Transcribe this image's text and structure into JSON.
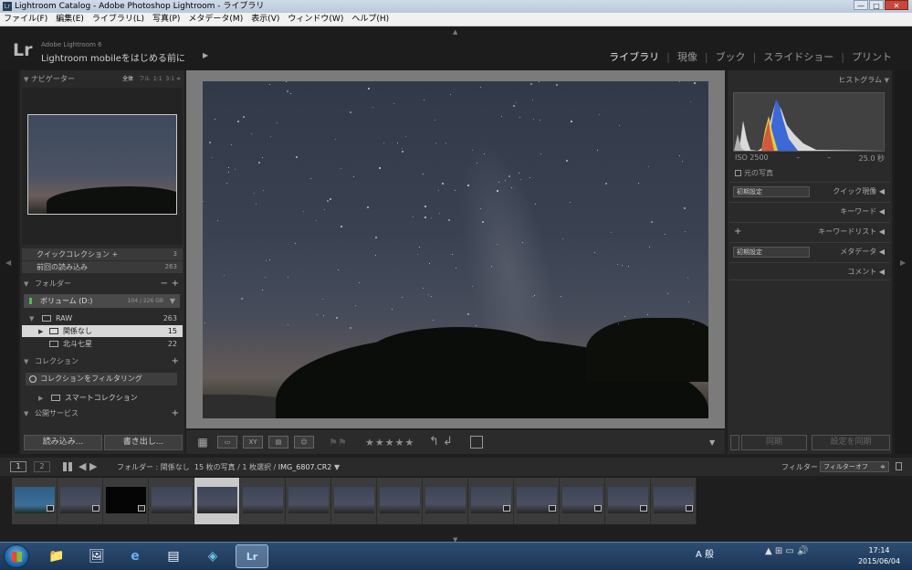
{
  "window": {
    "title": "Lightroom Catalog - Adobe Photoshop Lightroom - ライブラリ",
    "controls": {
      "minimize": "—",
      "maximize": "□",
      "close": "✕"
    }
  },
  "menu": [
    "ファイル(F)",
    "編集(E)",
    "ライブラリ(L)",
    "写真(P)",
    "メタデータ(M)",
    "表示(V)",
    "ウィンドウ(W)",
    "ヘルプ(H)"
  ],
  "identity_plate": {
    "logo": "Lr",
    "product": "Adobe Lightroom 6",
    "mobile_bold": "Lightroom mobile",
    "mobile_rest": "をはじめる前に",
    "play_icon": "play-triangle-icon"
  },
  "modules": [
    "ライブラリ",
    "現像",
    "ブック",
    "スライドショー",
    "プリント"
  ],
  "active_module": "ライブラリ",
  "left_panel": {
    "navigator": {
      "title": "ナビゲーター",
      "zoom_options": [
        "全体",
        "フル",
        "1:1",
        "3:1"
      ],
      "active_zoom": "全体"
    },
    "catalog": [
      {
        "label": "クイックコレクション +",
        "count": "3"
      },
      {
        "label": "前回の読み込み",
        "count": "263"
      }
    ],
    "folders": {
      "title": "フォルダー",
      "add": "+",
      "remove": "−",
      "volume": {
        "label": "ボリューム (D:)",
        "space": "104 / 226 GB"
      },
      "items": [
        {
          "label": "RAW",
          "count": "263",
          "selected": false
        },
        {
          "label": "関係なし",
          "count": "15",
          "selected": true
        },
        {
          "label": "北斗七星",
          "count": "22",
          "selected": false
        }
      ]
    },
    "collections": {
      "title": "コレクション",
      "add": "+",
      "filter_placeholder": "コレクションをフィルタリング",
      "items": [
        "スマートコレクション"
      ]
    },
    "publish": {
      "title": "公開サービス",
      "add": "+"
    },
    "buttons": {
      "import": "読み込み...",
      "export": "書き出し..."
    }
  },
  "toolbar": {
    "view_modes": [
      "grid-view-icon",
      "loupe-view-icon",
      "compare-view-icon",
      "survey-view-icon",
      "people-view-icon"
    ],
    "compare_label": "XY",
    "stars": "★★★★★",
    "flags": "⚑⚑",
    "rotate": "↰ ↲"
  },
  "right_panel": {
    "histogram": {
      "title": "ヒストグラム",
      "iso": "ISO 2500",
      "dash1": "–",
      "dash2": "–",
      "shutter": "25.0 秒",
      "original_photo": "元の写真"
    },
    "quick_develop": {
      "preset": "初期設定",
      "label": "クイック現像"
    },
    "keywording": {
      "label": "キーワード"
    },
    "keyword_list": {
      "add": "+",
      "label": "キーワードリスト"
    },
    "metadata": {
      "preset": "初期設定",
      "label": "メタデータ"
    },
    "comments": {
      "label": "コメント"
    },
    "buttons": {
      "sync": "同期",
      "sync_settings": "設定を同期"
    }
  },
  "filmstrip_bar": {
    "monitor1": "1",
    "monitor2": "2",
    "source_prefix": "フォルダー : 関係なし",
    "source_count": "15 枚の写真 / 1 枚選択 / ",
    "source_file": "IMG_6807.CR2",
    "filter_label": "フィルター :",
    "filter_value": "フィルターオフ"
  },
  "filmstrip": {
    "count": 15,
    "selected_index": 4
  },
  "taskbar": {
    "apps": [
      "folder-icon",
      "media-icon",
      "ie-icon",
      "news-icon",
      "nav-icon",
      "lightroom-icon"
    ],
    "lightroom_label": "Lr",
    "ime": "A 般",
    "clock_time": "17:14",
    "clock_date": "2015/06/04"
  },
  "colors": {
    "accent": "#e8e8e8",
    "panel": "#2a2a2a",
    "background": "#1f1f1f",
    "taskbar": "#1b3556"
  }
}
